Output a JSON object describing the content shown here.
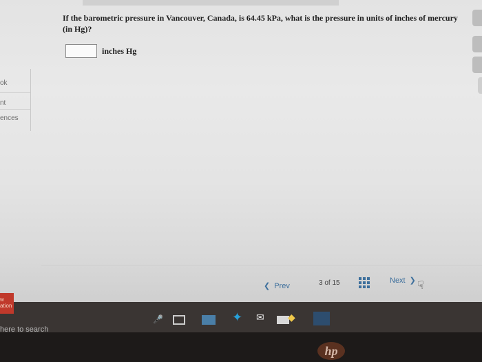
{
  "question": {
    "text": "If the barometric pressure in Vancouver, Canada, is 64.45 kPa, what is the pressure in units of inches of mercury (in Hg)?"
  },
  "answer": {
    "value": "",
    "units": "inches Hg"
  },
  "sidebar": {
    "items": [
      {
        "label": "ok"
      },
      {
        "label": "nt"
      },
      {
        "label": "ences"
      }
    ]
  },
  "navigation": {
    "prev_label": "Prev",
    "progress_text": "3 of 15",
    "next_label": "Next",
    "current": 3,
    "total": 15
  },
  "badge": {
    "line1": "w",
    "line2": "ation"
  },
  "taskbar": {
    "search_text": "here to search"
  },
  "brand": {
    "logo_text": "hp"
  },
  "colors": {
    "link": "#3d6f9c",
    "badge": "#c0392b",
    "taskbar": "#3a3533"
  }
}
